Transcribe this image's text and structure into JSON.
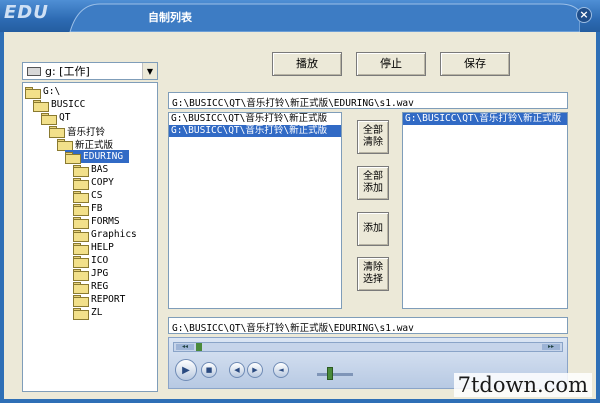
{
  "window": {
    "logo": "EDU",
    "title": "自制列表",
    "close_glyph": "×"
  },
  "drive": {
    "label": "g: [工作]"
  },
  "tree": [
    {
      "label": "G:\\",
      "level": 0,
      "selected": false
    },
    {
      "label": "BUSICC",
      "level": 1,
      "selected": false
    },
    {
      "label": "QT",
      "level": 2,
      "selected": false
    },
    {
      "label": "音乐打铃",
      "level": 3,
      "selected": false
    },
    {
      "label": "新正式版",
      "level": 4,
      "selected": false
    },
    {
      "label": "EDURING",
      "level": 5,
      "selected": true
    },
    {
      "label": "BAS",
      "level": 6,
      "selected": false
    },
    {
      "label": "COPY",
      "level": 6,
      "selected": false
    },
    {
      "label": "CS",
      "level": 6,
      "selected": false
    },
    {
      "label": "FB",
      "level": 6,
      "selected": false
    },
    {
      "label": "FORMS",
      "level": 6,
      "selected": false
    },
    {
      "label": "Graphics",
      "level": 6,
      "selected": false
    },
    {
      "label": "HELP",
      "level": 6,
      "selected": false
    },
    {
      "label": "ICO",
      "level": 6,
      "selected": false
    },
    {
      "label": "JPG",
      "level": 6,
      "selected": false
    },
    {
      "label": "REG",
      "level": 6,
      "selected": false
    },
    {
      "label": "REPORT",
      "level": 6,
      "selected": false
    },
    {
      "label": "ZL",
      "level": 6,
      "selected": false
    }
  ],
  "buttons": {
    "play": "播放",
    "stop": "停止",
    "save": "保存",
    "clear_all_1": "全部",
    "clear_all_2": "清除",
    "add_all_1": "全部",
    "add_all_2": "添加",
    "add": "添加",
    "clear_sel_1": "清除",
    "clear_sel_2": "选择"
  },
  "path_top": "G:\\BUSICC\\QT\\音乐打铃\\新正式版\\EDURING\\s1.wav",
  "file_list": [
    {
      "text": "G:\\BUSICC\\QT\\音乐打铃\\新正式版",
      "selected": false
    },
    {
      "text": "G:\\BUSICC\\QT\\音乐打铃\\新正式版",
      "selected": true
    }
  ],
  "playlist": [
    {
      "text": "G:\\BUSICC\\QT\\音乐打铃\\新正式版",
      "selected": true
    }
  ],
  "path_bottom": "G:\\BUSICC\\QT\\音乐打铃\\新正式版\\EDURING\\s1.wav",
  "player": {
    "seek_back": "◂◂",
    "seek_fwd": "▸▸",
    "play_glyph": "▶",
    "stop_glyph": "■",
    "prev_glyph": "◀",
    "next_glyph": "▶",
    "mute_glyph": "◄",
    "volume_level": 0.35
  },
  "watermark": "7tdown.com",
  "colors": {
    "titlebar": "#2e6fb6",
    "selection": "#316ac5",
    "client": "#ece9d8"
  }
}
